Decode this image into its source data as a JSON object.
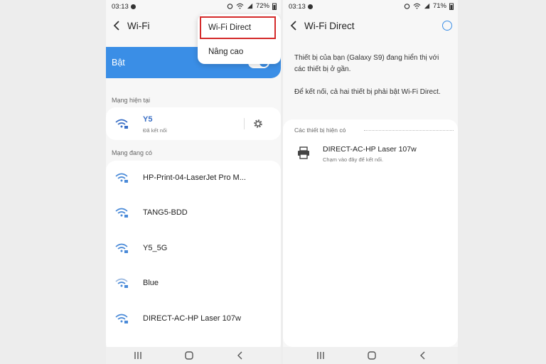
{
  "status": {
    "left_time": "03:13",
    "left_battery": "72%",
    "right_time": "03:13",
    "right_battery": "71%"
  },
  "left": {
    "title": "Wi-Fi",
    "menu": {
      "item1": "Wi-Fi Direct",
      "item2": "Nâng cao"
    },
    "toggle_label": "Bật",
    "current_section": "Mạng hiện tại",
    "current": {
      "name": "Y5",
      "status": "Đã kết nối"
    },
    "available_section": "Mạng đang có",
    "networks": [
      {
        "name": "HP-Print-04-LaserJet Pro M..."
      },
      {
        "name": "TANG5-BDD"
      },
      {
        "name": "Y5_5G"
      },
      {
        "name": "Blue"
      },
      {
        "name": "DIRECT-AC-HP Laser 107w"
      }
    ]
  },
  "right": {
    "title": "Wi-Fi Direct",
    "para1": "Thiết bị của bạn (Galaxy S9) đang hiển thị với các thiết bị ở gần.",
    "para2": "Để kết nối, cả hai thiết bị phải bật Wi-Fi Direct.",
    "section": "Các thiết bị hiện có",
    "device": {
      "name": "DIRECT-AC-HP Laser 107w",
      "hint": "Chạm vào đây để kết nối."
    }
  },
  "colors": {
    "accent": "#3a8ee6",
    "highlight": "#d42a2a"
  },
  "icons": [
    "back-arrow-icon",
    "wifi-icon",
    "gear-icon",
    "printer-icon",
    "search-circle-icon",
    "nav-recents-icon",
    "nav-home-icon",
    "nav-back-icon"
  ]
}
